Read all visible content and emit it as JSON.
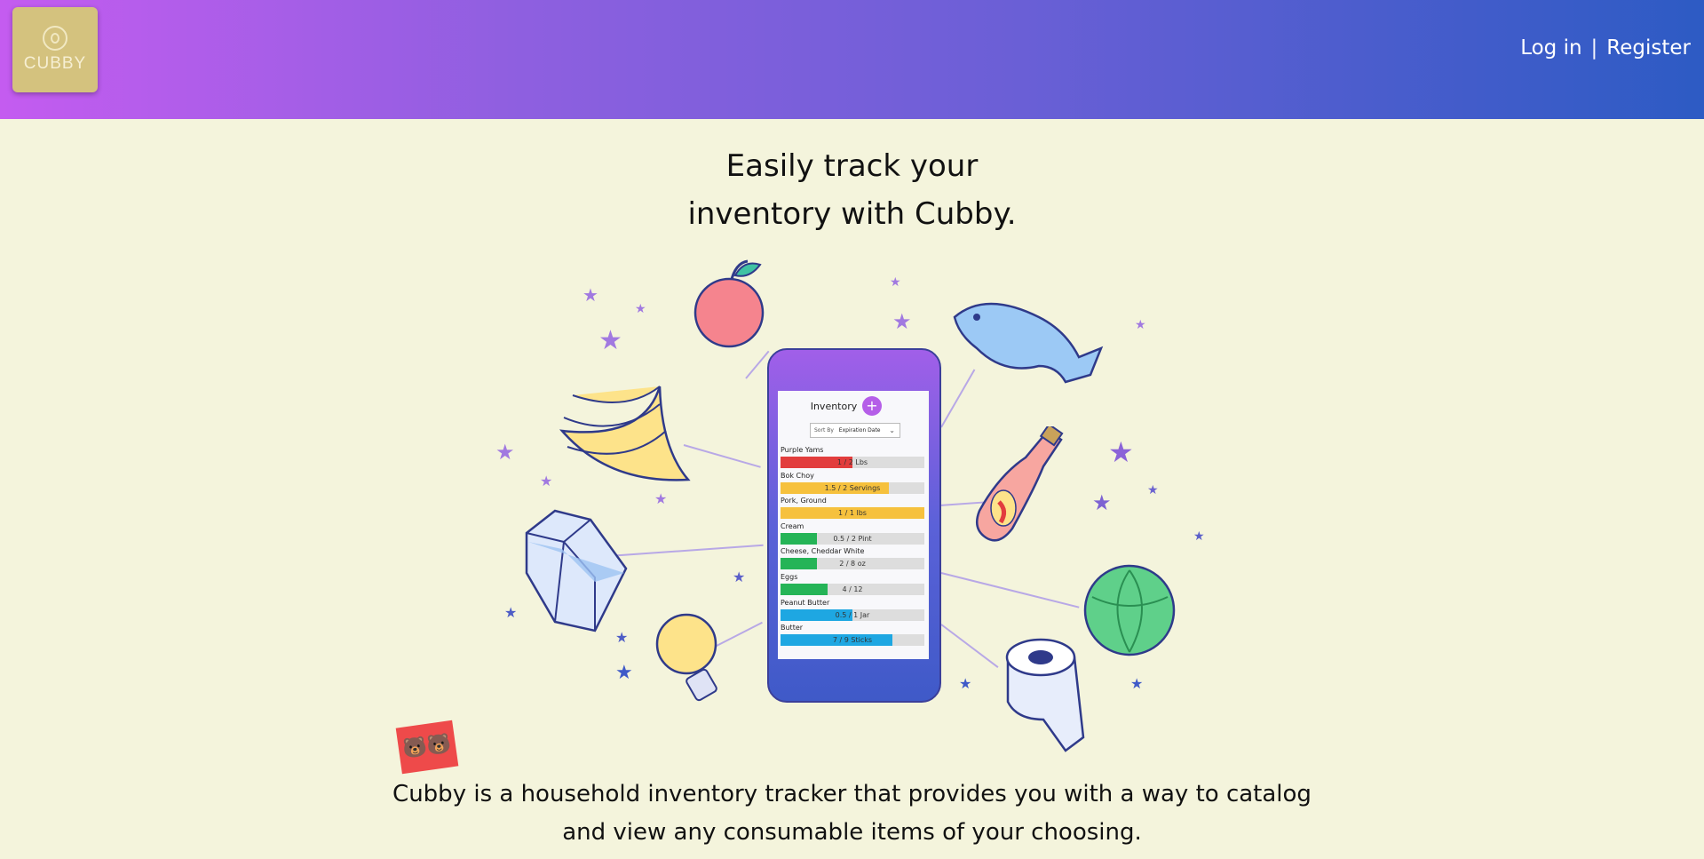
{
  "header": {
    "logo_text": "CUBBY",
    "login_label": "Log in",
    "separator": "|",
    "register_label": "Register"
  },
  "hero": {
    "title_line1": "Easily track your",
    "title_line2": "inventory with Cubby."
  },
  "phone": {
    "screen_title": "Inventory",
    "sort_label": "Sort By",
    "sort_value": "Expiration Date",
    "items": [
      {
        "name": "Purple Yams",
        "value": "1 / 2 Lbs",
        "fraction": 0.5,
        "color": "#e23d3d"
      },
      {
        "name": "Bok Choy",
        "value": "1.5 / 2 Servings",
        "fraction": 0.75,
        "color": "#f6c13d"
      },
      {
        "name": "Pork, Ground",
        "value": "1 / 1 lbs",
        "fraction": 1.0,
        "color": "#f6c13d"
      },
      {
        "name": "Cream",
        "value": "0.5 / 2 Pint",
        "fraction": 0.25,
        "color": "#25b457"
      },
      {
        "name": "Cheese, Cheddar White",
        "value": "2 / 8 oz",
        "fraction": 0.25,
        "color": "#25b457"
      },
      {
        "name": "Eggs",
        "value": "4 / 12",
        "fraction": 0.33,
        "color": "#25b457"
      },
      {
        "name": "Peanut Butter",
        "value": "0.5 / 1 Jar",
        "fraction": 0.5,
        "color": "#1ea7e2"
      },
      {
        "name": "Butter",
        "value": "7 / 9 Sticks",
        "fraction": 0.78,
        "color": "#1ea7e2"
      }
    ]
  },
  "sticker": {
    "emoji": "🐻🐻"
  },
  "description": {
    "line1": "Cubby is a household inventory tracker that provides you with a way to catalog",
    "line2": "and view any consumable items of your choosing."
  },
  "colors": {
    "accent": "#b55ee8",
    "background": "#f4f4dc"
  }
}
